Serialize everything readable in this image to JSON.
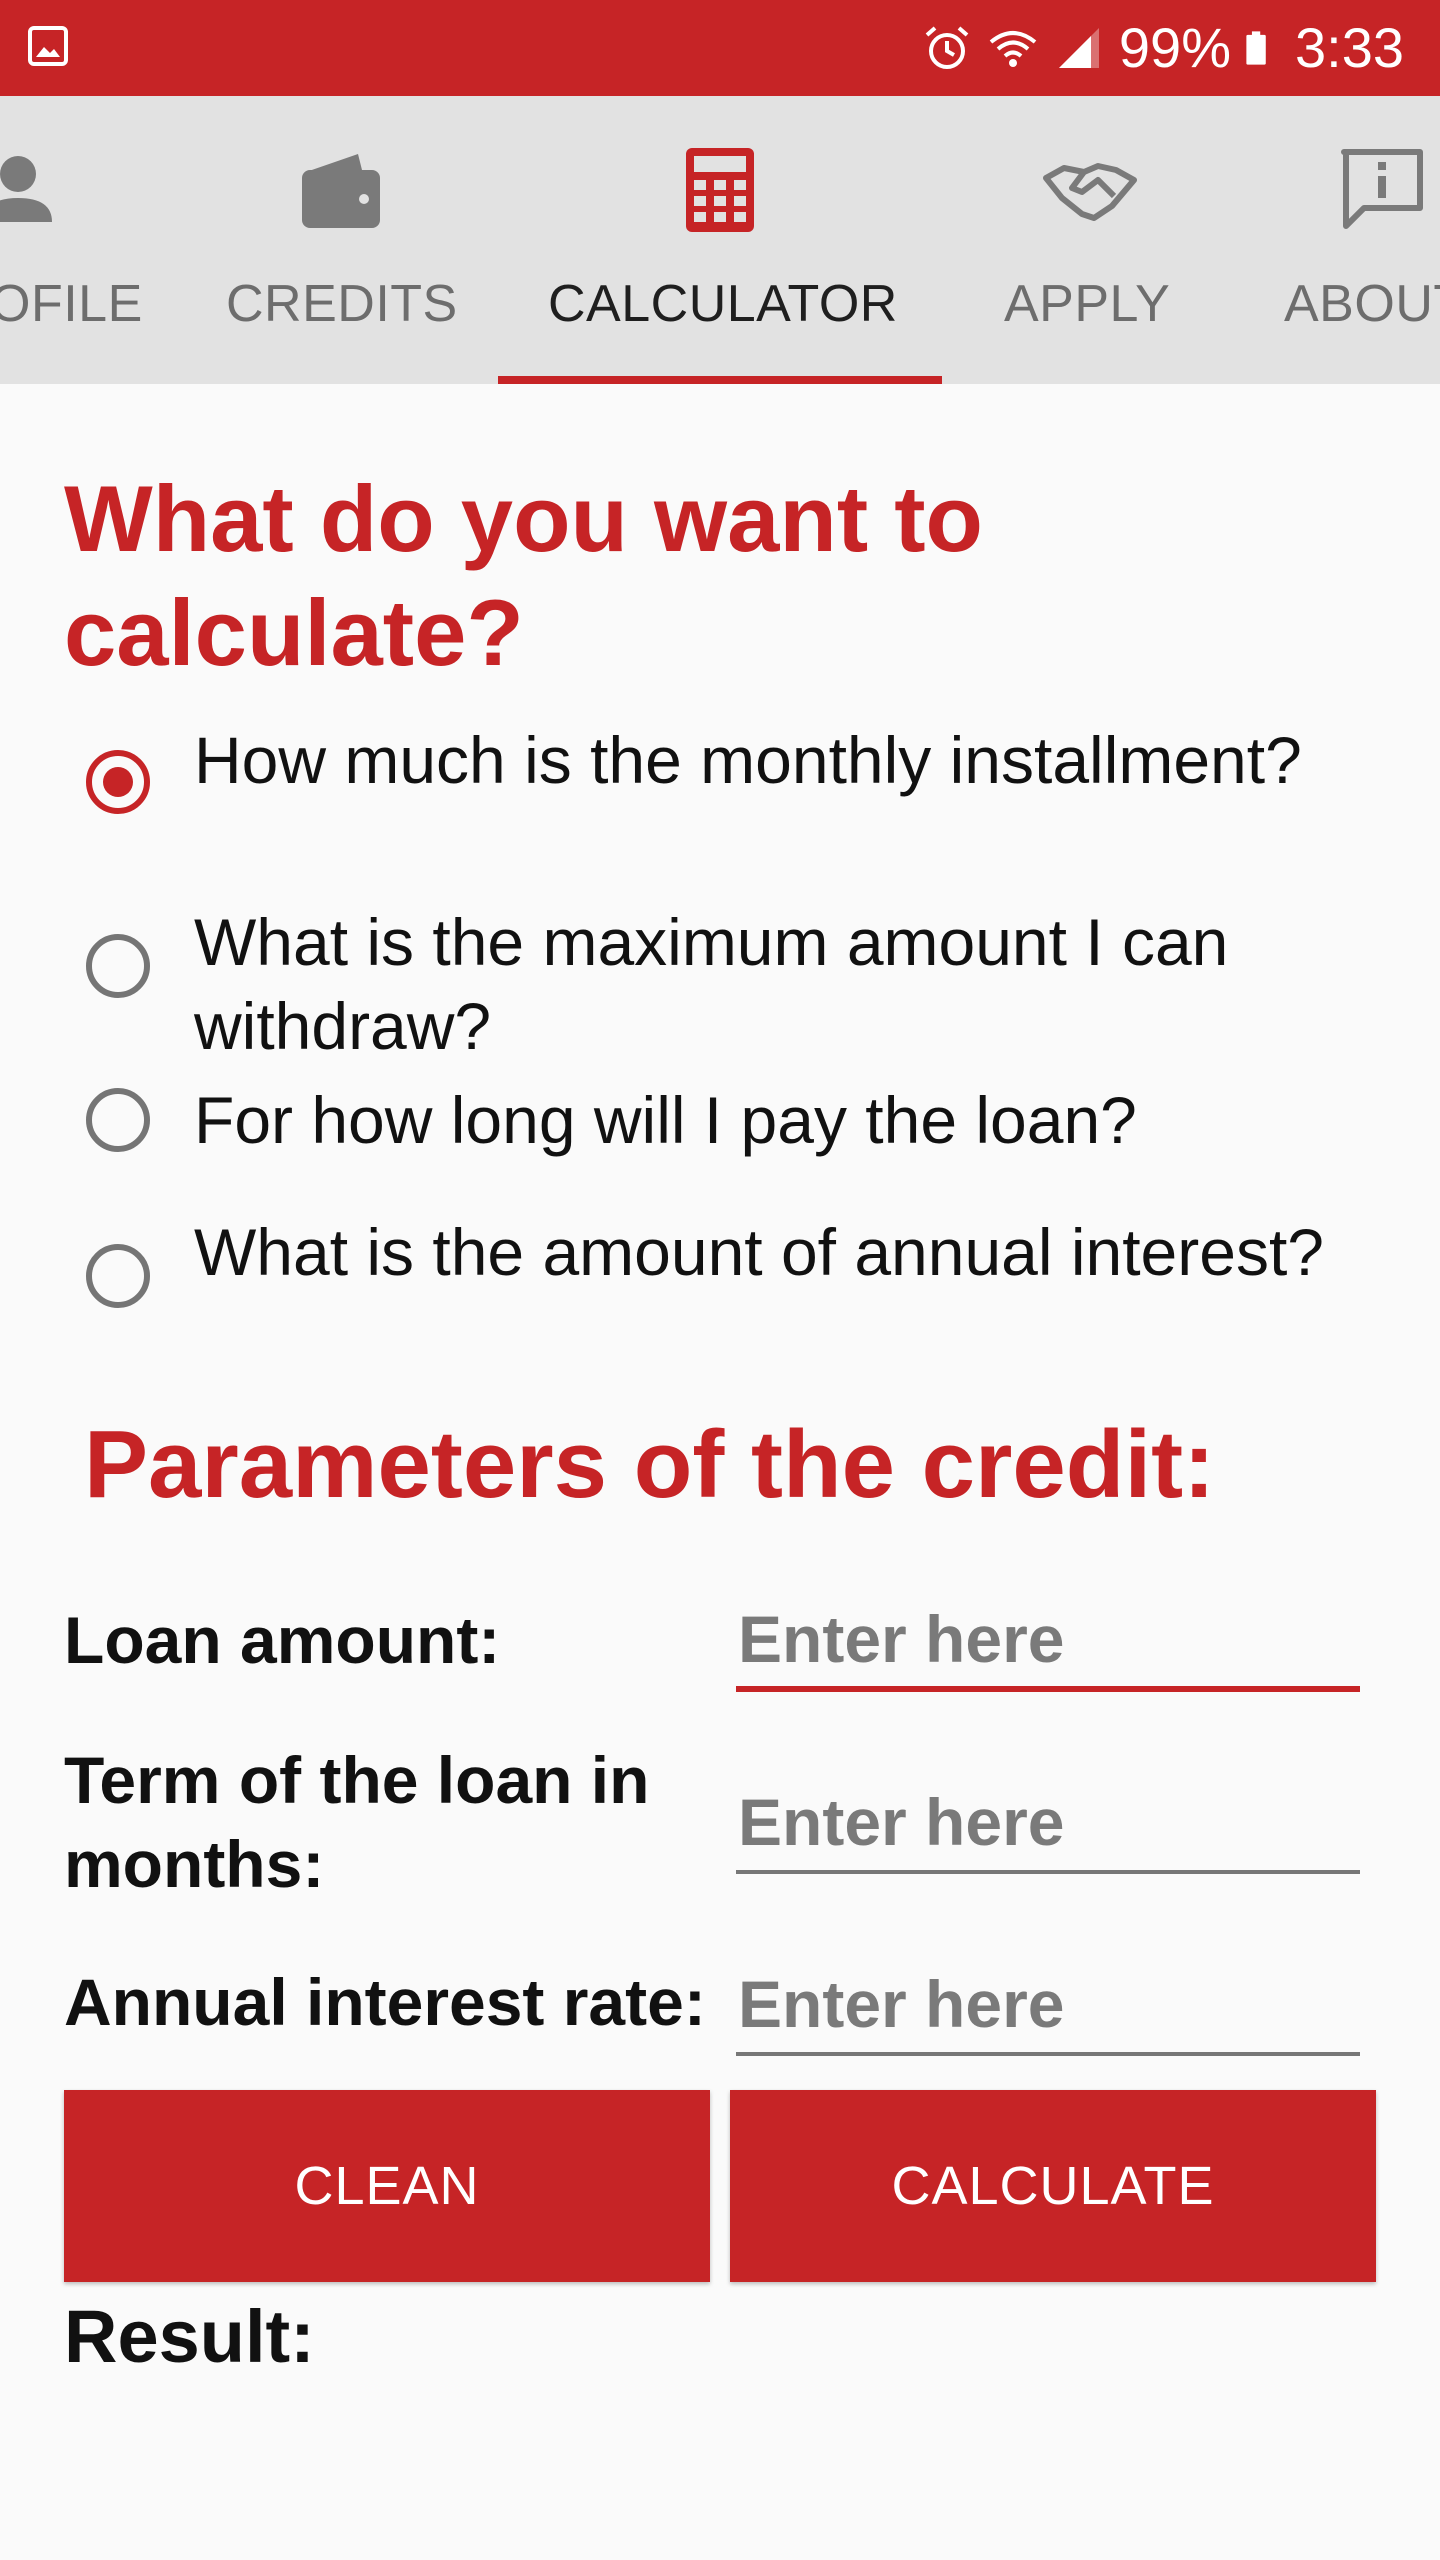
{
  "status_bar": {
    "battery": "99%",
    "time": "3:33",
    "icons": [
      "image-icon",
      "alarm-icon",
      "wifi-icon",
      "signal-icon",
      "battery-icon"
    ]
  },
  "tabs": [
    {
      "label": "OFILE",
      "icon": "person-icon"
    },
    {
      "label": "CREDITS",
      "icon": "wallet-icon"
    },
    {
      "label": "CALCULATOR",
      "icon": "calculator-icon",
      "active": true
    },
    {
      "label": "APPLY",
      "icon": "handshake-icon"
    },
    {
      "label": "ABOUT",
      "icon": "info-feedback-icon"
    }
  ],
  "question_title": "What do you want to calculate?",
  "options": [
    {
      "label": "How much is the monthly installment?",
      "checked": true
    },
    {
      "label": "What is the maximum amount I can withdraw?",
      "checked": false
    },
    {
      "label": "For how long will I pay the loan?",
      "checked": false
    },
    {
      "label": "What is the amount of annual interest?",
      "checked": false
    }
  ],
  "params_title": "Parameters of the credit:",
  "fields": {
    "loan_amount": {
      "label": "Loan amount:",
      "placeholder": "Enter here",
      "value": ""
    },
    "term": {
      "label": "Term of the loan in months:",
      "placeholder": "Enter here",
      "value": ""
    },
    "interest": {
      "label": "Annual interest rate:",
      "placeholder": "Enter here",
      "value": ""
    }
  },
  "buttons": {
    "clean": "CLEAN",
    "calculate": "CALCULATE"
  },
  "result_label": "Result:",
  "colors": {
    "accent": "#c62426",
    "tab_bar": "#e2e2e2",
    "background": "#fafafa"
  }
}
